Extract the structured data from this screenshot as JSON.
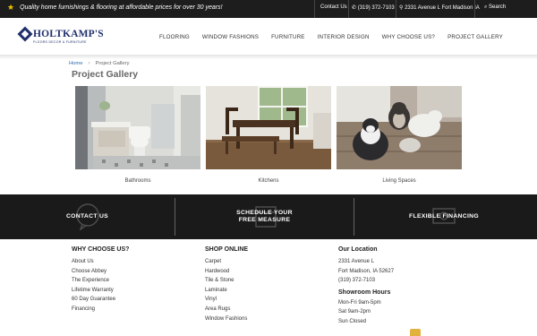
{
  "topbar": {
    "tagline": "Quality home furnishings & flooring at affordable prices for over 30 years!",
    "contact_label": "Contact Us",
    "phone": "(319) 372-7103",
    "address": "2331 Avenue L Fort Madison IA",
    "search_label": "Search"
  },
  "brand": {
    "name": "HOLTKAMP'S",
    "tagline": "FLOORS DECOR & FURNITURE",
    "primary_color": "#1f2f6b"
  },
  "nav": {
    "items": [
      "FLOORING",
      "WINDOW FASHIONS",
      "FURNITURE",
      "INTERIOR DESIGN",
      "WHY CHOOSE US?",
      "PROJECT GALLERY"
    ]
  },
  "breadcrumb": {
    "home": "Home",
    "separator": "›",
    "current": "Project Gallery"
  },
  "page": {
    "title": "Project Gallery"
  },
  "gallery": [
    {
      "label": "Bathrooms"
    },
    {
      "label": "Kitchens"
    },
    {
      "label": "Living Spaces"
    }
  ],
  "cta_band": {
    "items": [
      "CONTACT US",
      "SCHEDULE YOUR\nFREE MEASURE",
      "FLEXIBLE FINANCING"
    ]
  },
  "footer": {
    "why": {
      "heading": "WHY CHOOSE US?",
      "links": [
        "About Us",
        "Choose Abbey",
        "The Experience",
        "Lifetime Warranty",
        "60 Day Guarantee",
        "Financing"
      ]
    },
    "shop": {
      "heading": "SHOP ONLINE",
      "links": [
        "Carpet",
        "Hardwood",
        "Tile & Stone",
        "Laminate",
        "Vinyl",
        "Area Rugs",
        "Window Fashions"
      ]
    },
    "location": {
      "heading": "Our Location",
      "address_line1": "2331 Avenue L",
      "address_line2": "Fort Madison, IA 52627",
      "phone": "(319) 372-7103",
      "hours_heading": "Showroom Hours",
      "hours": [
        "Mon-Fri 9am-5pm",
        "Sat 9am-2pm",
        "Sun Closed"
      ]
    }
  }
}
